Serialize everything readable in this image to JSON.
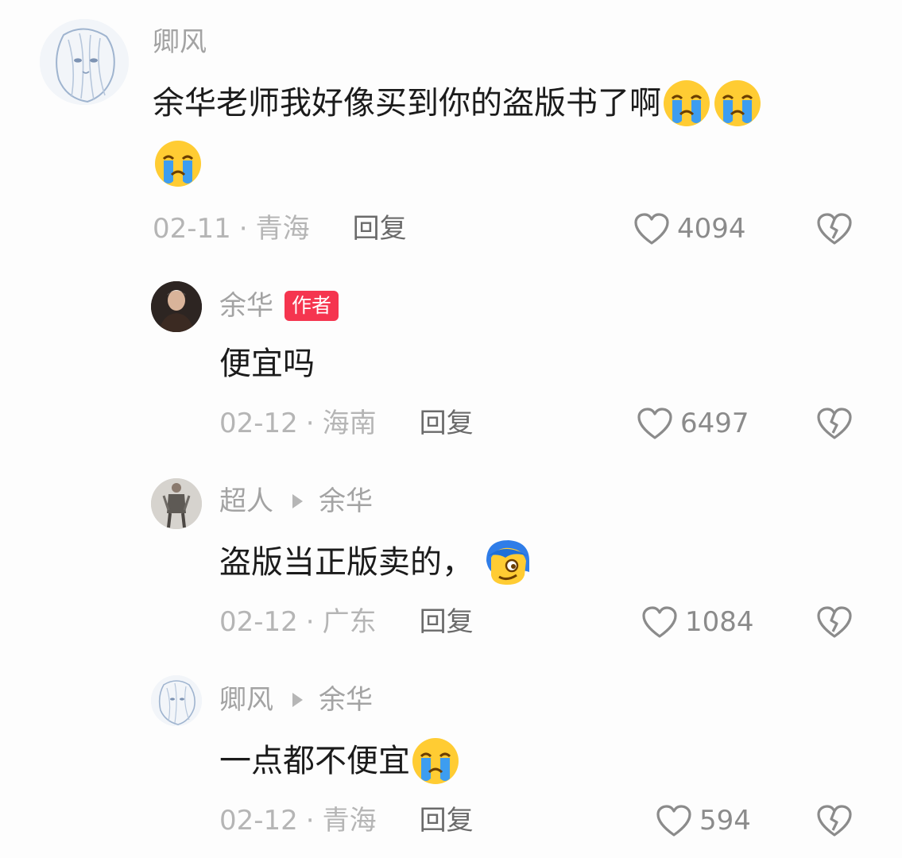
{
  "comments": [
    {
      "username": "卿风",
      "text": "余华老师我好像买到你的盗版书了啊",
      "emojis": [
        "crying-emoji",
        "crying-emoji",
        "crying-emoji"
      ],
      "date": "02-11",
      "separator": "·",
      "location": "青海",
      "reply_label": "回复",
      "likes": "4094"
    },
    {
      "username": "余华",
      "badge": "作者",
      "text": "便宜吗",
      "date": "02-12",
      "separator": "·",
      "location": "海南",
      "reply_label": "回复",
      "likes": "6497"
    },
    {
      "username": "超人",
      "reply_to": "余华",
      "text": "盗版当正版卖的，",
      "emojis": [
        "smirk-emoji"
      ],
      "date": "02-12",
      "separator": "·",
      "location": "广东",
      "reply_label": "回复",
      "likes": "1084"
    },
    {
      "username": "卿风",
      "reply_to": "余华",
      "text": "一点都不便宜",
      "emojis": [
        "crying-emoji"
      ],
      "date": "02-12",
      "separator": "·",
      "location": "青海",
      "reply_label": "回复",
      "likes": "594"
    }
  ],
  "colors": {
    "background": "#fdfdfd",
    "username": "#a3a3a3",
    "badge": "#f5354f",
    "meta": "#b5b5b5",
    "reply": "#6a6a6a",
    "icon": "#8b8b8b"
  }
}
